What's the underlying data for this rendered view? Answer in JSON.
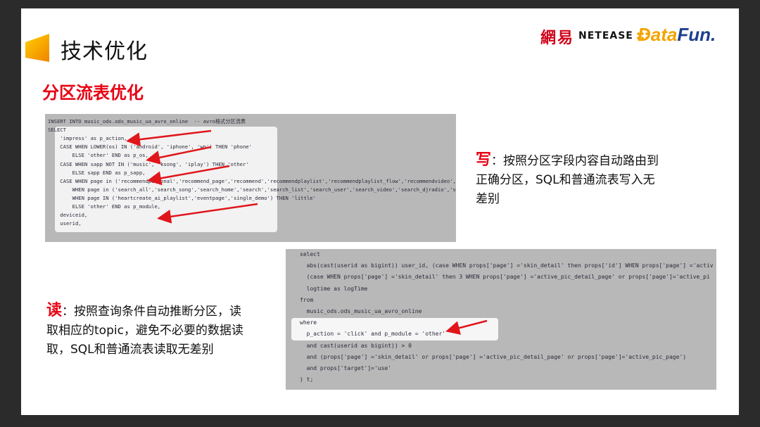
{
  "header": {
    "title": "技术优化",
    "logo_netease_cn": "網易",
    "logo_netease_en": "NETEASE",
    "logo_datafun_a": "Data",
    "logo_datafun_b": "Fun."
  },
  "subtitle": "分区流表优化",
  "code_block_1": {
    "lines": [
      "INSERT INTO music_ods.ods_music_ua_avro_online  -- avro格式分区流表",
      "SELECT",
      "    'impress' as p_action,",
      "    CASE WHEN LOWER(os) IN ('android', 'iphone', 'wp') THEN 'phone'",
      "        ELSE 'other' END as p_os,",
      "    CASE WHEN sapp NOT IN ('music', 'ksong', 'iplay') THEN 'other'",
      "        ELSE sapp END as p_sapp,",
      "    CASE WHEN page in ('recommendpersonal','recommend_page','recommend','recommendplaylist','recommendplaylist_flow','recommendvideo','dailyre",
      "        WHEN page in ('search_all','search_song','search_home','search','search_list','search_user','search_video','search_djradio','search_ar",
      "        WHEN page IN ('heartcreate_ai_playlist','eventpage','single_demo') THEN 'little'",
      "        ELSE 'other' END as p_module,",
      "    deviceid,",
      "    userid,"
    ]
  },
  "code_block_2": {
    "lines": [
      "select",
      "  abs(cast(userid as bigint)) user_id, (case WHEN props['page'] ='skin_detail' then props['id'] WHEN props['page'] ='activ",
      "  (case WHEN props['page'] ='skin_detail' then 3 WHEN props['page'] ='active_pic_detail_page' or props['page']='active_pi",
      "  logtime as logTime",
      "from",
      "  music_ods.ods_music_ua_avro_online",
      "where",
      "  p_action = 'click' and p_module = 'other'",
      "  and cast(userid as bigint)) > 0",
      "  and (props['page'] ='skin_detail' or props['page'] ='active_pic_detail_page' or props['page']='active_pic_page')",
      "  and props['target']='use'",
      ") t;"
    ]
  },
  "write_desc": {
    "label": "写",
    "text_1": "：按照分区字段内容自动路由到",
    "text_2": "正确分区，SQL和普通流表写入无",
    "text_3": "差别"
  },
  "read_desc": {
    "label": "读",
    "text_1": "：按照查询条件自动推断分区，读",
    "text_2": "取相应的topic，避免不必要的数据读",
    "text_3": "取，SQL和普通流表读取无差别"
  },
  "colors": {
    "accent_red": "#e60012",
    "accent_orange": "#f39800",
    "arrow_red": "#e0161b"
  }
}
